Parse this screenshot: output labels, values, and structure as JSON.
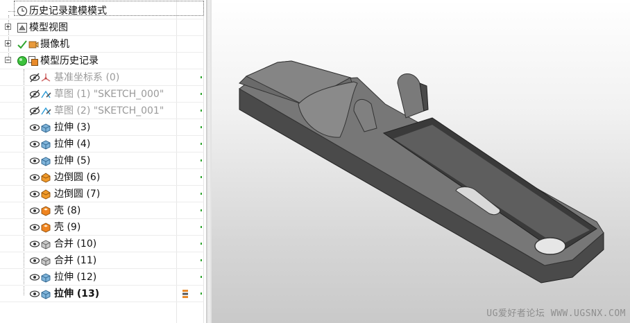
{
  "tree": {
    "items": [
      {
        "label": "历史记录建模模式",
        "icon": "clock-icon",
        "state": "normal"
      },
      {
        "label": "模型视图",
        "icon": "model-view-icon",
        "state": "normal",
        "expander": "plus"
      },
      {
        "label": "摄像机",
        "icon": "camera-icon",
        "state": "normal",
        "expander": "plus"
      },
      {
        "label": "模型历史记录",
        "icon": "history-icon",
        "state": "normal",
        "expander": "minus"
      },
      {
        "label": "基准坐标系 (0)",
        "icon": "datum-csys-icon",
        "state": "hidden"
      },
      {
        "label": "草图 (1) \"SKETCH_000\"",
        "icon": "sketch-icon",
        "state": "hidden"
      },
      {
        "label": "草图 (2) \"SKETCH_001\"",
        "icon": "sketch-icon",
        "state": "hidden"
      },
      {
        "label": "拉伸 (3)",
        "icon": "extrude-icon",
        "state": "visible"
      },
      {
        "label": "拉伸 (4)",
        "icon": "extrude-icon",
        "state": "visible"
      },
      {
        "label": "拉伸 (5)",
        "icon": "extrude-icon",
        "state": "visible"
      },
      {
        "label": "边倒圆 (6)",
        "icon": "edge-blend-icon",
        "state": "visible"
      },
      {
        "label": "边倒圆 (7)",
        "icon": "edge-blend-icon",
        "state": "visible"
      },
      {
        "label": "壳 (8)",
        "icon": "shell-icon",
        "state": "visible"
      },
      {
        "label": "壳 (9)",
        "icon": "shell-icon",
        "state": "visible"
      },
      {
        "label": "合并 (10)",
        "icon": "unite-icon",
        "state": "visible"
      },
      {
        "label": "合并 (11)",
        "icon": "unite-icon",
        "state": "visible"
      },
      {
        "label": "拉伸 (12)",
        "icon": "extrude-icon",
        "state": "visible"
      },
      {
        "label": "拉伸 (13)",
        "icon": "extrude-icon",
        "state": "current"
      }
    ]
  },
  "viewport": {
    "watermark": "UG爱好者论坛 WWW.UGSNX.COM"
  },
  "colors": {
    "hidden_text": "#9a9a9a",
    "check_green": "#2fa52f",
    "model_body": "#6f6f6f"
  }
}
